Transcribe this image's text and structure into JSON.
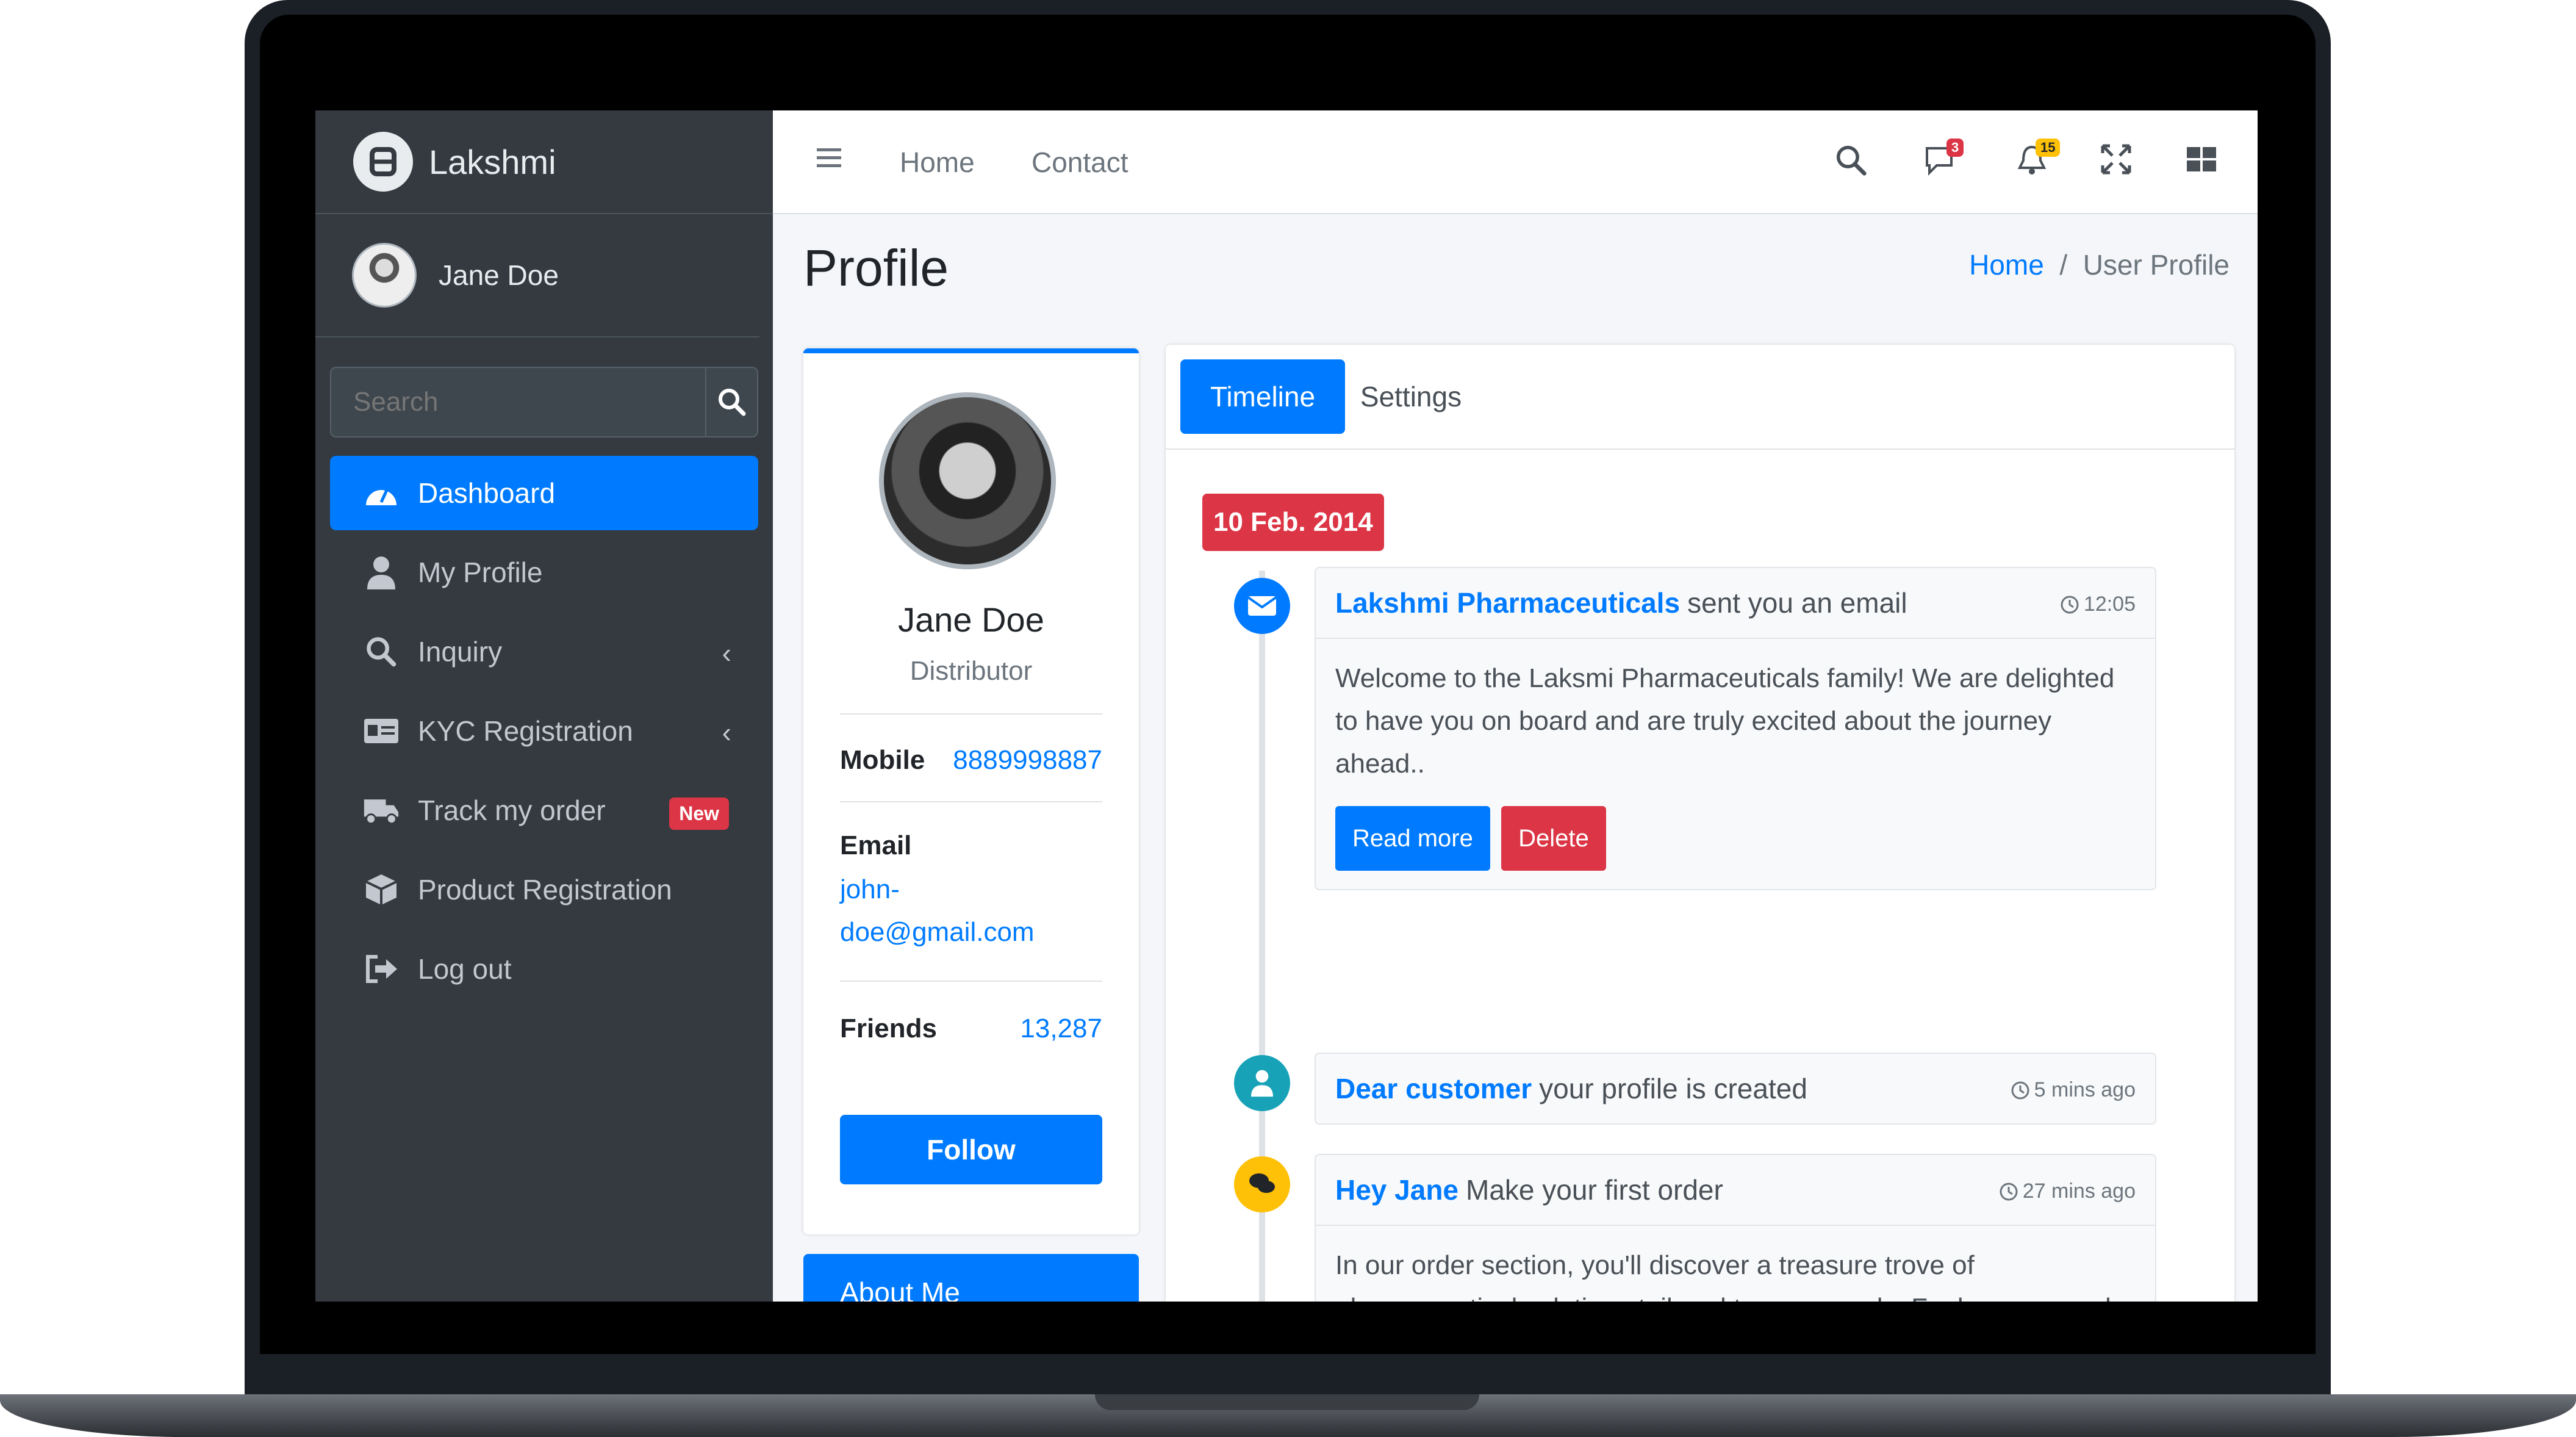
{
  "app": {
    "brand": "Lakshmi"
  },
  "user": {
    "name": "Jane Doe"
  },
  "sidebar": {
    "search_placeholder": "Search",
    "items": [
      {
        "label": "Dashboard",
        "icon": "tachometer-icon",
        "active": true
      },
      {
        "label": "My Profile",
        "icon": "user-icon"
      },
      {
        "label": "Inquiry",
        "icon": "search-icon",
        "has_submenu": true
      },
      {
        "label": "KYC Registration",
        "icon": "id-card-icon",
        "has_submenu": true
      },
      {
        "label": "Track my order",
        "icon": "truck-icon",
        "badge": "New"
      },
      {
        "label": "Product Registration",
        "icon": "box-icon"
      },
      {
        "label": "Log out",
        "icon": "sign-out-icon"
      }
    ]
  },
  "topbar": {
    "links": [
      "Home",
      "Contact"
    ],
    "messages_badge": "3",
    "notifications_badge": "15"
  },
  "page": {
    "title": "Profile",
    "breadcrumb": [
      "Home",
      "User Profile"
    ]
  },
  "profile": {
    "name": "Jane Doe",
    "role": "Distributor",
    "mobile_label": "Mobile",
    "mobile": "8889998887",
    "email_label": "Email",
    "email_line1": "john-",
    "email_line2": "doe@gmail.com",
    "friends_label": "Friends",
    "friends": "13,287",
    "follow_label": "Follow",
    "about_label": "About Me"
  },
  "timeline": {
    "tabs": [
      "Timeline",
      "Settings"
    ],
    "date": "10 Feb. 2014",
    "items": [
      {
        "who": "Lakshmi Pharmaceuticals",
        "action": "sent you an email",
        "time": "12:05",
        "body": "Welcome to the Laksmi Pharmaceuticals family! We are delighted to have you on board and are truly excited about the journey ahead..",
        "read_more": "Read more",
        "delete": "Delete"
      },
      {
        "who": "Dear customer",
        "action": "your profile is created",
        "time": "5 mins ago"
      },
      {
        "who": "Hey Jane",
        "action": "Make your first order",
        "time": "27 mins ago",
        "body": "In our order section, you'll discover a treasure trove of pharmaceutical solutions tailored to your needs. Feel empowered to explore and select what resonates with you. Should you need any assistance or guidance along the way, our"
      }
    ]
  },
  "colors": {
    "primary": "#007bff",
    "danger": "#dc3545",
    "sidebar": "#343a40",
    "info": "#17a2b8",
    "warning": "#ffc107"
  }
}
